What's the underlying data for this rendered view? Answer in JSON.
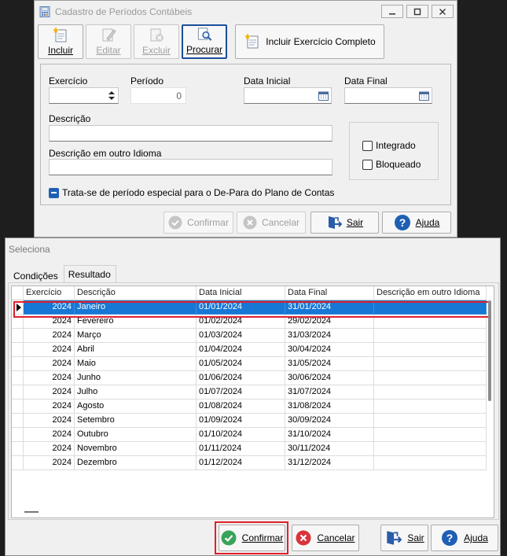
{
  "bg_window": {
    "title": "Cadastro de Períodos Contábeis",
    "toolbar": {
      "incluir": "Incluir",
      "editar": "Editar",
      "excluir": "Excluir",
      "procurar": "Procurar",
      "incluir_exercicio": "Incluir Exercício Completo"
    },
    "form": {
      "exercicio_label": "Exercício",
      "periodo_label": "Período",
      "periodo_value": "0",
      "data_inicial_label": "Data Inicial",
      "data_final_label": "Data Final",
      "descricao_label": "Descrição",
      "descricao_idioma_label": "Descrição em outro Idioma",
      "integrado_label": "Integrado",
      "bloqueado_label": "Bloqueado",
      "especial_label": "Trata-se de período especial para o De-Para do Plano de Contas"
    },
    "actions": {
      "confirmar": "Confirmar",
      "cancelar": "Cancelar",
      "sair": "Sair",
      "ajuda": "Ajuda"
    }
  },
  "dialog": {
    "title": "Seleciona",
    "tabs": [
      "Condições",
      "Resultado"
    ],
    "active_tab": "Resultado",
    "columns": [
      "Exercício",
      "Descrição",
      "Data Inicial",
      "Data Final",
      "Descrição em outro Idioma"
    ],
    "rows": [
      {
        "exercicio": "2024",
        "descricao": "Janeiro",
        "data_inicial": "01/01/2024",
        "data_final": "31/01/2024",
        "idioma": ""
      },
      {
        "exercicio": "2024",
        "descricao": "Fevereiro",
        "data_inicial": "01/02/2024",
        "data_final": "29/02/2024",
        "idioma": ""
      },
      {
        "exercicio": "2024",
        "descricao": "Março",
        "data_inicial": "01/03/2024",
        "data_final": "31/03/2024",
        "idioma": ""
      },
      {
        "exercicio": "2024",
        "descricao": "Abril",
        "data_inicial": "01/04/2024",
        "data_final": "30/04/2024",
        "idioma": ""
      },
      {
        "exercicio": "2024",
        "descricao": "Maio",
        "data_inicial": "01/05/2024",
        "data_final": "31/05/2024",
        "idioma": ""
      },
      {
        "exercicio": "2024",
        "descricao": "Junho",
        "data_inicial": "01/06/2024",
        "data_final": "30/06/2024",
        "idioma": ""
      },
      {
        "exercicio": "2024",
        "descricao": "Julho",
        "data_inicial": "01/07/2024",
        "data_final": "31/07/2024",
        "idioma": ""
      },
      {
        "exercicio": "2024",
        "descricao": "Agosto",
        "data_inicial": "01/08/2024",
        "data_final": "31/08/2024",
        "idioma": ""
      },
      {
        "exercicio": "2024",
        "descricao": "Setembro",
        "data_inicial": "01/09/2024",
        "data_final": "30/09/2024",
        "idioma": ""
      },
      {
        "exercicio": "2024",
        "descricao": "Outubro",
        "data_inicial": "01/10/2024",
        "data_final": "31/10/2024",
        "idioma": ""
      },
      {
        "exercicio": "2024",
        "descricao": "Novembro",
        "data_inicial": "01/11/2024",
        "data_final": "30/11/2024",
        "idioma": ""
      },
      {
        "exercicio": "2024",
        "descricao": "Dezembro",
        "data_inicial": "01/12/2024",
        "data_final": "31/12/2024",
        "idioma": ""
      }
    ],
    "selected_row": 0,
    "buttons": {
      "confirmar": "Confirmar",
      "cancelar": "Cancelar",
      "sair": "Sair",
      "ajuda": "Ajuda"
    }
  },
  "colors": {
    "selection": "#1777d4",
    "highlight_frame": "#e0202a",
    "confirm_green": "#3aa35a",
    "cancel_red": "#d9343b",
    "help_blue": "#1e5fb4"
  }
}
